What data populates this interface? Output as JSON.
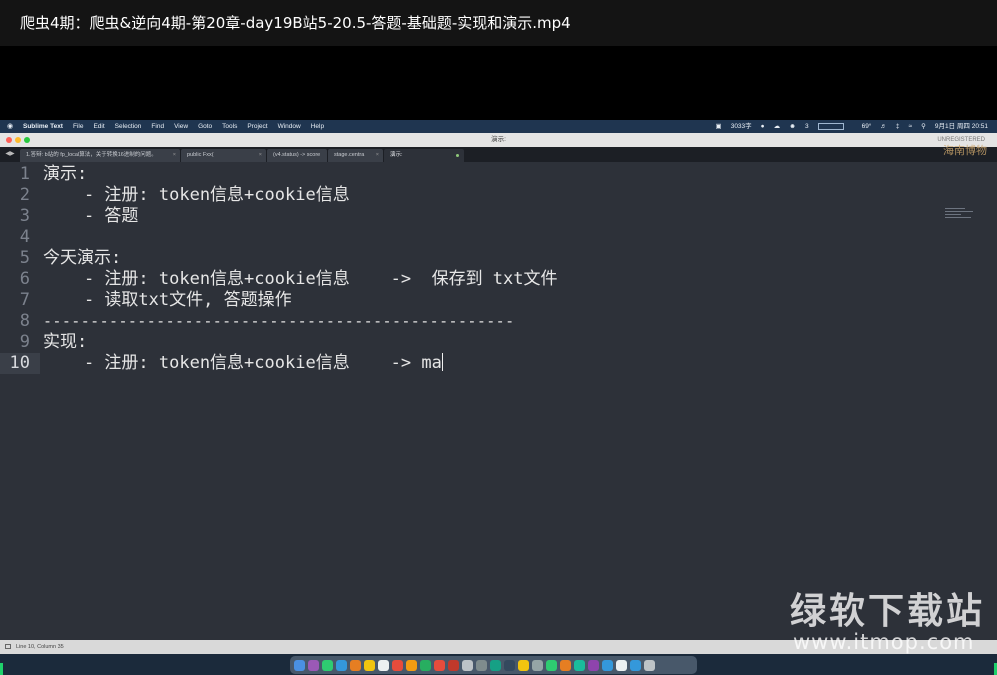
{
  "player": {
    "title": "爬虫4期：爬虫&逆向4期-第20章-day19B站5-20.5-答题-基础题-实现和演示.mp4"
  },
  "menubar": {
    "apple_icon": "apple-icon",
    "items": [
      "Sublime Text",
      "File",
      "Edit",
      "Selection",
      "Find",
      "View",
      "Goto",
      "Tools",
      "Project",
      "Window",
      "Help"
    ],
    "status": {
      "battery_text": "3033字",
      "count": "3",
      "temperature": "69°",
      "datetime": "9月1日 周四 20:51"
    }
  },
  "window": {
    "title": "演示:",
    "unregistered": "UNREGISTERED",
    "traffic_colors": [
      "#fe5f57",
      "#febc2e",
      "#28c840"
    ]
  },
  "tabs": [
    {
      "label": "1.答辩: b站的 fp_local算法，关于转换16进制的问题。",
      "active": false
    },
    {
      "label": "public Fxx(",
      "active": false
    },
    {
      "label": "(v4.status) -> score",
      "active": false
    },
    {
      "label": "stage.centra",
      "active": false
    },
    {
      "label": "演示:",
      "active": true
    }
  ],
  "watermark_small": "海南博物",
  "editor": {
    "lines": [
      {
        "num": "1",
        "text": "演示:"
      },
      {
        "num": "2",
        "text": "    - 注册: token信息+cookie信息"
      },
      {
        "num": "3",
        "text": "    - 答题"
      },
      {
        "num": "4",
        "text": ""
      },
      {
        "num": "5",
        "text": "今天演示:"
      },
      {
        "num": "6",
        "text": "    - 注册: token信息+cookie信息    ->  保存到 txt文件"
      },
      {
        "num": "7",
        "text": "    - 读取txt文件, 答题操作"
      },
      {
        "num": "8",
        "text": "--------------------------------------------------"
      },
      {
        "num": "9",
        "text": "实现:"
      },
      {
        "num": "10",
        "text": "    - 注册: token信息+cookie信息    -> ma"
      }
    ],
    "current_line": 10
  },
  "statusbar": {
    "position": "Line 10, Column 35"
  },
  "dock": {
    "colors": [
      "#4a90e2",
      "#9b59b6",
      "#2ecc71",
      "#3498db",
      "#e67e22",
      "#f1c40f",
      "#ecf0f1",
      "#e74c3c",
      "#f39c12",
      "#27ae60",
      "#e74c3c",
      "#c0392b",
      "#bdc3c7",
      "#7f8c8d",
      "#16a085",
      "#34495e",
      "#f1c40f",
      "#95a5a6",
      "#2ecc71",
      "#e67e22",
      "#1abc9c",
      "#8e44ad",
      "#3498db",
      "#ecf0f1",
      "#3498db",
      "#bdc3c7"
    ]
  },
  "site_watermark": {
    "name": "绿软下载站",
    "url": "www.itmop.com"
  }
}
